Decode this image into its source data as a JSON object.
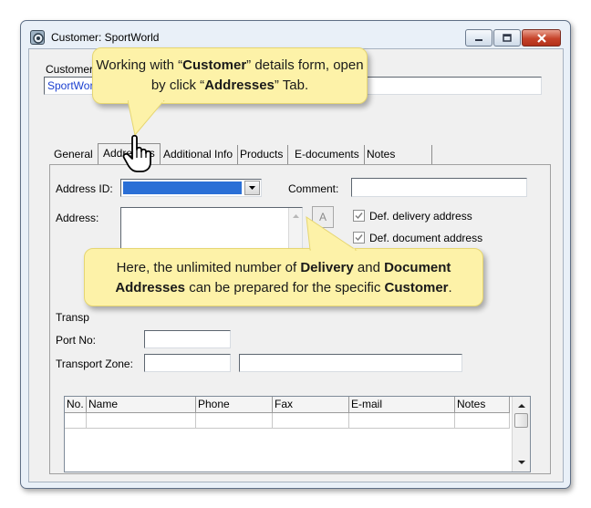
{
  "window": {
    "title": "Customer: SportWorld",
    "buttons": {
      "minimize": "minimize",
      "maximize": "maximize",
      "close": "close"
    }
  },
  "header": {
    "customer_label": "Customer",
    "customer_value": "SportWor"
  },
  "tabs": [
    {
      "label": "General",
      "active": false
    },
    {
      "label": "Addresses",
      "active": true
    },
    {
      "label": "Additional Info",
      "active": false
    },
    {
      "label": "Products",
      "active": false
    },
    {
      "label": "E-documents",
      "active": false
    },
    {
      "label": "Notes",
      "active": false
    }
  ],
  "addresses": {
    "address_id_label": "Address ID:",
    "comment_label": "Comment:",
    "address_label": "Address:",
    "a_button": "A",
    "def_delivery_label": "Def. delivery address",
    "def_document_label": "Def. document address",
    "def_delivery_checked": true,
    "def_document_checked": true,
    "transport_label": "Transp",
    "port_no_label": "Port No:",
    "transport_zone_label": "Transport Zone:"
  },
  "grid": {
    "columns": [
      "No.",
      "Name",
      "Phone",
      "Fax",
      "E-mail",
      "Notes"
    ],
    "rows": []
  },
  "callouts": {
    "top": {
      "p1": "Working with “",
      "b1": "Customer",
      "p2": "” details form, open by click “",
      "b2": "Addresses",
      "p3": "” Tab."
    },
    "middle": {
      "p1": "Here, the unlimited number of ",
      "b1": "Delivery",
      "p2": " and ",
      "b2": "Document Addresses",
      "p3": " can be prepared for the specific ",
      "b3": "Customer",
      "p4": "."
    }
  },
  "colors": {
    "callout_bg": "#fdf2a8",
    "selection": "#2a6fd6",
    "window_frame": "#e9f0f8",
    "close_button": "#c6432a"
  },
  "icons": [
    "app-icon",
    "minimize-icon",
    "maximize-icon",
    "close-icon",
    "dropdown-arrow-icon",
    "scroll-up-icon",
    "scroll-down-icon",
    "hand-cursor-icon",
    "checkbox-icon"
  ]
}
